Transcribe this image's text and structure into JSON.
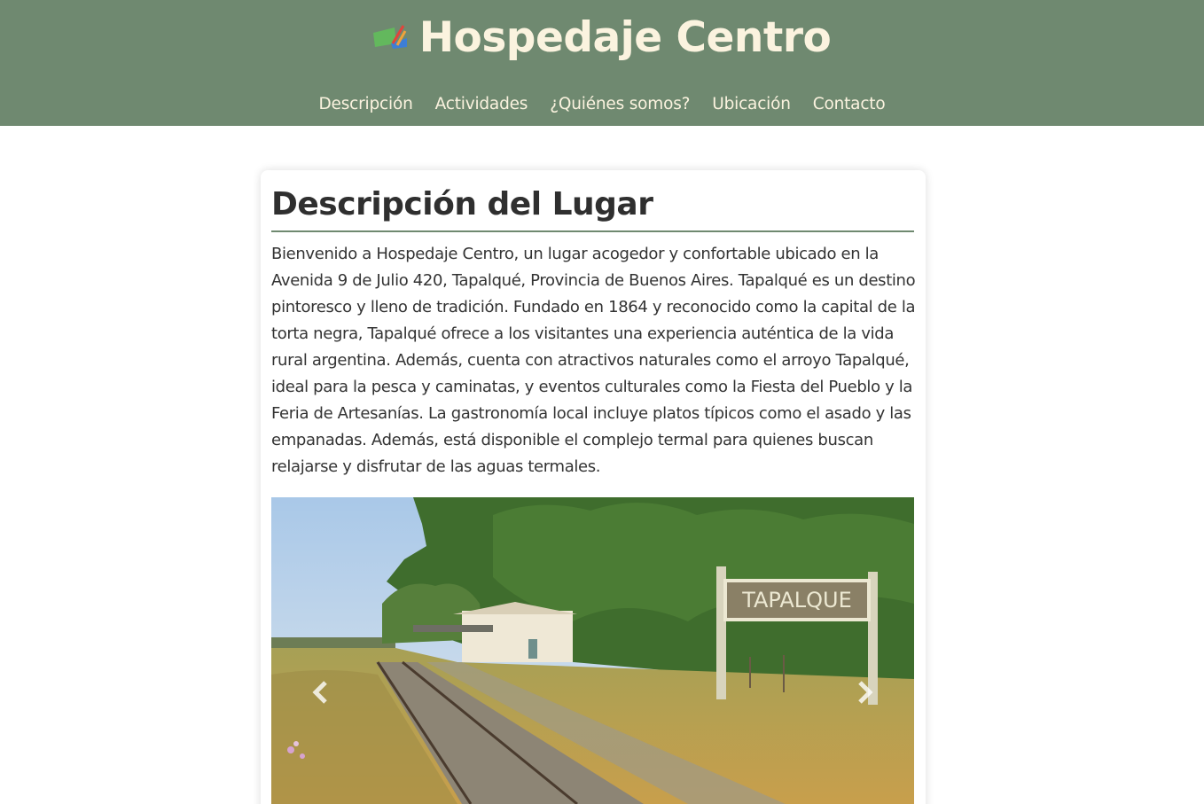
{
  "header": {
    "title": "Hospedaje Centro",
    "logo_icon": "palette-icon",
    "background_color": "#6f8970",
    "text_color": "#fbf3df"
  },
  "nav": {
    "items": [
      {
        "label": "Descripción"
      },
      {
        "label": "Actividades"
      },
      {
        "label": "¿Quiénes somos?"
      },
      {
        "label": "Ubicación"
      },
      {
        "label": "Contacto"
      }
    ]
  },
  "main": {
    "heading": "Descripción del Lugar",
    "description": "Bienvenido a Hospedaje Centro, un lugar acogedor y confortable ubicado en la Avenida 9 de Julio 420, Tapalqué, Provincia de Buenos Aires. Tapalqué es un destino pintoresco y lleno de tradición. Fundado en 1864 y reconocido como la capital de la torta negra, Tapalqué ofrece a los visitantes una experiencia auténtica de la vida rural argentina. Además, cuenta con atractivos naturales como el arroyo Tapalqué, ideal para la pesca y caminatas, y eventos culturales como la Fiesta del Pueblo y la Feria de Artesanías. La gastronomía local incluye platos típicos como el asado y las empanadas. Además, está disponible el complejo termal para quienes buscan relajarse y disfrutar de las aguas termales."
  },
  "carousel": {
    "slide_sign_text": "TAPALQUE",
    "prev_icon": "chevron-left-icon",
    "next_icon": "chevron-right-icon"
  }
}
